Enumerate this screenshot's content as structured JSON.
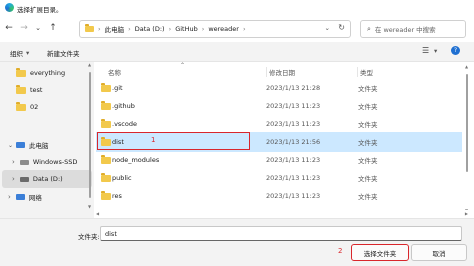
{
  "window": {
    "title": "选择扩展目录。"
  },
  "address": {
    "segments": [
      "此电脑",
      "Data (D:)",
      "GitHub",
      "wereader"
    ]
  },
  "search": {
    "placeholder": "在 wereader 中搜索"
  },
  "toolbar": {
    "organize": "组织",
    "new_folder": "新建文件夹"
  },
  "sidebar": {
    "items": [
      {
        "label": "everything"
      },
      {
        "label": "test"
      },
      {
        "label": "02"
      },
      {
        "label": "此电脑"
      },
      {
        "label": "Windows-SSD"
      },
      {
        "label": "Data (D:)"
      },
      {
        "label": "网络"
      }
    ]
  },
  "columns": {
    "name": "名称",
    "date": "修改日期",
    "type": "类型"
  },
  "files": [
    {
      "name": ".git",
      "date": "2023/1/13 21:28",
      "type": "文件夹"
    },
    {
      "name": ".github",
      "date": "2023/1/13 11:23",
      "type": "文件夹"
    },
    {
      "name": ".vscode",
      "date": "2023/1/13 11:23",
      "type": "文件夹"
    },
    {
      "name": "dist",
      "date": "2023/1/13 21:56",
      "type": "文件夹"
    },
    {
      "name": "node_modules",
      "date": "2023/1/13 11:23",
      "type": "文件夹"
    },
    {
      "name": "public",
      "date": "2023/1/13 11:23",
      "type": "文件夹"
    },
    {
      "name": "res",
      "date": "2023/1/13 11:23",
      "type": "文件夹"
    }
  ],
  "annotations": {
    "one": "1",
    "two": "2"
  },
  "footer": {
    "folder_label": "文件夹:",
    "folder_value": "dist",
    "select_button": "选择文件夹",
    "cancel_button": "取消"
  },
  "colors": {
    "selected_row": "#cce8ff",
    "annotation_red": "#d9262c",
    "folder_yellow": "#f2c94c",
    "accent": "#0067c0"
  }
}
